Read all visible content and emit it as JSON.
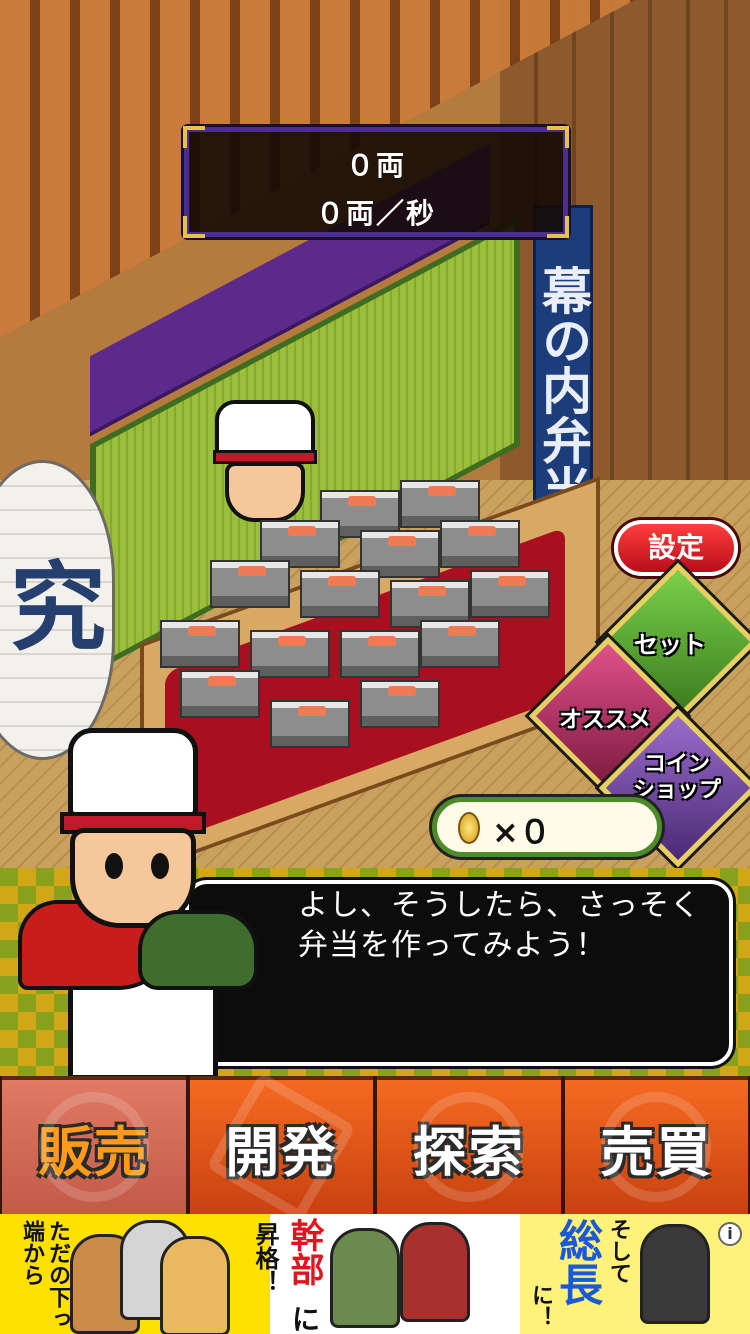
{
  "hud": {
    "total": "０両",
    "rate": "０両／秒"
  },
  "scene": {
    "banner_text": "幕の内弁当",
    "lantern_text": "究"
  },
  "buttons": {
    "settings": "設定",
    "set": "セット",
    "recommend": "オススメ",
    "coin_shop": "コイン\nショップ"
  },
  "coins": {
    "count_text": "×０"
  },
  "dialog": {
    "line1": "よし、そうしたら、さっそく",
    "line2": "弁当を作ってみよう！"
  },
  "tabs": [
    {
      "label": "販売"
    },
    {
      "label": "開発"
    },
    {
      "label": "探索"
    },
    {
      "label": "売買"
    }
  ],
  "ad": {
    "left_text": "ただの下っ端から",
    "mid_text_1": "幹部",
    "mid_text_2": "に",
    "mid_text_3": "昇格！",
    "right_text_1": "そして",
    "right_text_2": "総長",
    "right_text_3": "に！",
    "info": "i"
  },
  "colors": {
    "hud_border": "#4b2e8f",
    "settings_red": "#d61b25",
    "set_green": "#4e9c2c",
    "recommend_pink": "#c2366a",
    "coinshop_purple": "#6a3f9a",
    "tab_orange": "#e35a1a",
    "ad_yellow": "#ffe100"
  }
}
